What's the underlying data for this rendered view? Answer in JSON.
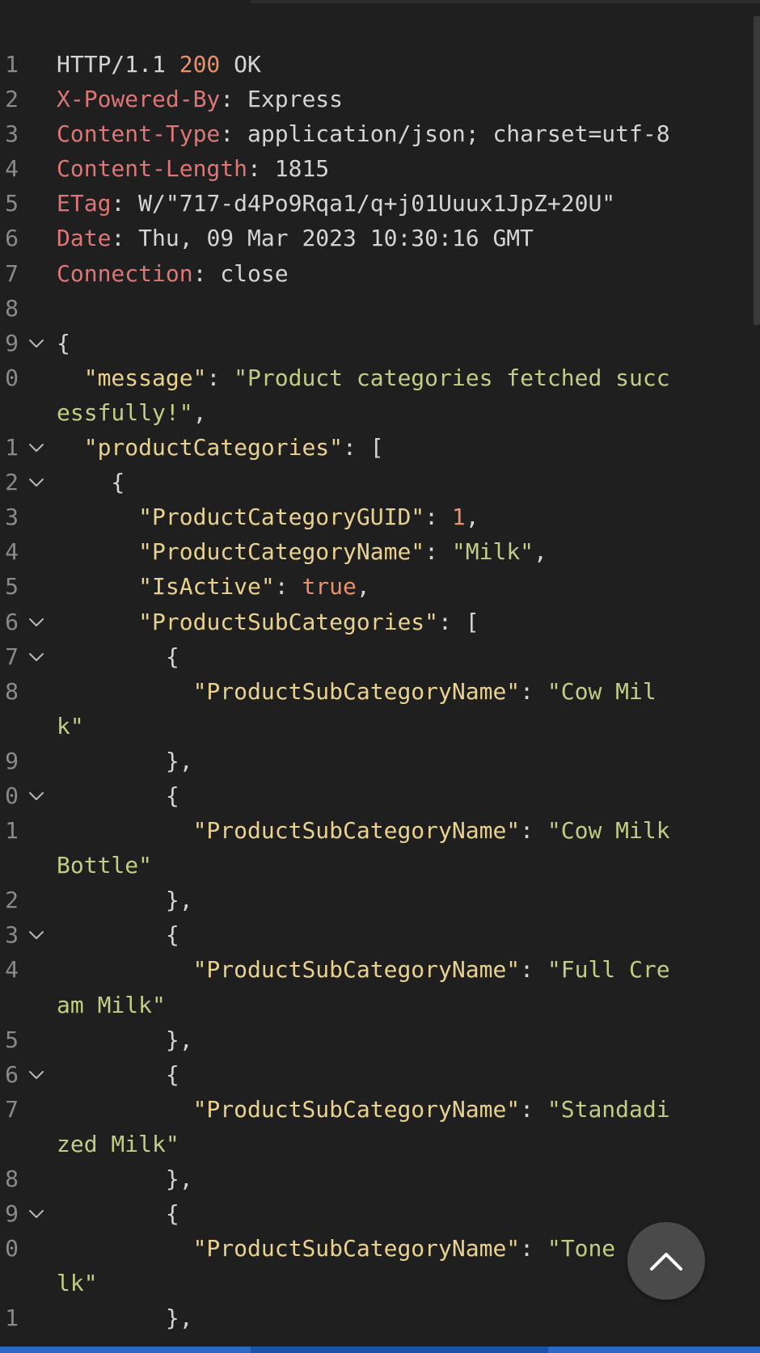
{
  "colors": {
    "background": "#1f1f1f",
    "line_number": "#8a8a8a",
    "key": "#e9d18f",
    "string": "#c3cc84",
    "number": "#e8916a",
    "header_name": "#dd7676",
    "text": "#d4d4d4",
    "status_bar": "#2c6bc4"
  },
  "lines": [
    {
      "num": "1",
      "fold": false,
      "tokens": [
        {
          "t": "HTTP/1.1 ",
          "c": "p"
        },
        {
          "t": "200",
          "c": "n"
        },
        {
          "t": " OK",
          "c": "p"
        }
      ]
    },
    {
      "num": "2",
      "fold": false,
      "tokens": [
        {
          "t": "X-Powered-By",
          "c": "h"
        },
        {
          "t": ": Express",
          "c": "p"
        }
      ]
    },
    {
      "num": "3",
      "fold": false,
      "tokens": [
        {
          "t": "Content-Type",
          "c": "h"
        },
        {
          "t": ": application/json; charset=utf-8",
          "c": "p"
        }
      ]
    },
    {
      "num": "4",
      "fold": false,
      "tokens": [
        {
          "t": "Content-Length",
          "c": "h"
        },
        {
          "t": ": 1815",
          "c": "p"
        }
      ]
    },
    {
      "num": "5",
      "fold": false,
      "tokens": [
        {
          "t": "ETag",
          "c": "h"
        },
        {
          "t": ": W/\"717-d4Po9Rqa1/q+j01Uuux1JpZ+20U\"",
          "c": "p"
        }
      ]
    },
    {
      "num": "6",
      "fold": false,
      "tokens": [
        {
          "t": "Date",
          "c": "h"
        },
        {
          "t": ": Thu, 09 Mar 2023 10:30:16 GMT",
          "c": "p"
        }
      ]
    },
    {
      "num": "7",
      "fold": false,
      "tokens": [
        {
          "t": "Connection",
          "c": "h"
        },
        {
          "t": ": close",
          "c": "p"
        }
      ]
    },
    {
      "num": "8",
      "fold": false,
      "tokens": []
    },
    {
      "num": "9",
      "fold": true,
      "tokens": [
        {
          "t": "{",
          "c": "p"
        }
      ]
    },
    {
      "num": "0",
      "fold": false,
      "tokens": [
        {
          "t": "  ",
          "c": "p"
        },
        {
          "t": "\"message\"",
          "c": "k"
        },
        {
          "t": ": ",
          "c": "p"
        },
        {
          "t": "\"Product categories fetched succ",
          "c": "s"
        }
      ]
    },
    {
      "num": "",
      "fold": false,
      "tokens": [
        {
          "t": "essfully!\"",
          "c": "s"
        },
        {
          "t": ",",
          "c": "p"
        }
      ]
    },
    {
      "num": "1",
      "fold": true,
      "tokens": [
        {
          "t": "  ",
          "c": "p"
        },
        {
          "t": "\"productCategories\"",
          "c": "k"
        },
        {
          "t": ": [",
          "c": "p"
        }
      ]
    },
    {
      "num": "2",
      "fold": true,
      "tokens": [
        {
          "t": "    {",
          "c": "p"
        }
      ]
    },
    {
      "num": "3",
      "fold": false,
      "tokens": [
        {
          "t": "      ",
          "c": "p"
        },
        {
          "t": "\"ProductCategoryGUID\"",
          "c": "k"
        },
        {
          "t": ": ",
          "c": "p"
        },
        {
          "t": "1",
          "c": "n"
        },
        {
          "t": ",",
          "c": "p"
        }
      ]
    },
    {
      "num": "4",
      "fold": false,
      "tokens": [
        {
          "t": "      ",
          "c": "p"
        },
        {
          "t": "\"ProductCategoryName\"",
          "c": "k"
        },
        {
          "t": ": ",
          "c": "p"
        },
        {
          "t": "\"Milk\"",
          "c": "s"
        },
        {
          "t": ",",
          "c": "p"
        }
      ]
    },
    {
      "num": "5",
      "fold": false,
      "tokens": [
        {
          "t": "      ",
          "c": "p"
        },
        {
          "t": "\"IsActive\"",
          "c": "k"
        },
        {
          "t": ": ",
          "c": "p"
        },
        {
          "t": "true",
          "c": "n"
        },
        {
          "t": ",",
          "c": "p"
        }
      ]
    },
    {
      "num": "6",
      "fold": true,
      "tokens": [
        {
          "t": "      ",
          "c": "p"
        },
        {
          "t": "\"ProductSubCategories\"",
          "c": "k"
        },
        {
          "t": ": [",
          "c": "p"
        }
      ]
    },
    {
      "num": "7",
      "fold": true,
      "tokens": [
        {
          "t": "        {",
          "c": "p"
        }
      ]
    },
    {
      "num": "8",
      "fold": false,
      "tokens": [
        {
          "t": "          ",
          "c": "p"
        },
        {
          "t": "\"ProductSubCategoryName\"",
          "c": "k"
        },
        {
          "t": ": ",
          "c": "p"
        },
        {
          "t": "\"Cow Mil",
          "c": "s"
        }
      ]
    },
    {
      "num": "",
      "fold": false,
      "tokens": [
        {
          "t": "k\"",
          "c": "s"
        }
      ]
    },
    {
      "num": "9",
      "fold": false,
      "tokens": [
        {
          "t": "        },",
          "c": "p"
        }
      ]
    },
    {
      "num": "0",
      "fold": true,
      "tokens": [
        {
          "t": "        {",
          "c": "p"
        }
      ]
    },
    {
      "num": "1",
      "fold": false,
      "tokens": [
        {
          "t": "          ",
          "c": "p"
        },
        {
          "t": "\"ProductSubCategoryName\"",
          "c": "k"
        },
        {
          "t": ": ",
          "c": "p"
        },
        {
          "t": "\"Cow Milk",
          "c": "s"
        }
      ]
    },
    {
      "num": "",
      "fold": false,
      "tokens": [
        {
          "t": "Bottle\"",
          "c": "s"
        }
      ]
    },
    {
      "num": "2",
      "fold": false,
      "tokens": [
        {
          "t": "        },",
          "c": "p"
        }
      ]
    },
    {
      "num": "3",
      "fold": true,
      "tokens": [
        {
          "t": "        {",
          "c": "p"
        }
      ]
    },
    {
      "num": "4",
      "fold": false,
      "tokens": [
        {
          "t": "          ",
          "c": "p"
        },
        {
          "t": "\"ProductSubCategoryName\"",
          "c": "k"
        },
        {
          "t": ": ",
          "c": "p"
        },
        {
          "t": "\"Full Cre",
          "c": "s"
        }
      ]
    },
    {
      "num": "",
      "fold": false,
      "tokens": [
        {
          "t": "am Milk\"",
          "c": "s"
        }
      ]
    },
    {
      "num": "5",
      "fold": false,
      "tokens": [
        {
          "t": "        },",
          "c": "p"
        }
      ]
    },
    {
      "num": "6",
      "fold": true,
      "tokens": [
        {
          "t": "        {",
          "c": "p"
        }
      ]
    },
    {
      "num": "7",
      "fold": false,
      "tokens": [
        {
          "t": "          ",
          "c": "p"
        },
        {
          "t": "\"ProductSubCategoryName\"",
          "c": "k"
        },
        {
          "t": ": ",
          "c": "p"
        },
        {
          "t": "\"Standadi",
          "c": "s"
        }
      ]
    },
    {
      "num": "",
      "fold": false,
      "tokens": [
        {
          "t": "zed Milk\"",
          "c": "s"
        }
      ]
    },
    {
      "num": "8",
      "fold": false,
      "tokens": [
        {
          "t": "        },",
          "c": "p"
        }
      ]
    },
    {
      "num": "9",
      "fold": true,
      "tokens": [
        {
          "t": "        {",
          "c": "p"
        }
      ]
    },
    {
      "num": "0",
      "fold": false,
      "tokens": [
        {
          "t": "          ",
          "c": "p"
        },
        {
          "t": "\"ProductSubCategoryName\"",
          "c": "k"
        },
        {
          "t": ": ",
          "c": "p"
        },
        {
          "t": "\"Tone",
          "c": "s"
        }
      ]
    },
    {
      "num": "",
      "fold": false,
      "tokens": [
        {
          "t": "lk\"",
          "c": "s"
        }
      ]
    },
    {
      "num": "1",
      "fold": false,
      "tokens": [
        {
          "t": "        },",
          "c": "p"
        }
      ]
    }
  ],
  "scroll_top_button": {
    "icon": "chevron-up-icon"
  }
}
